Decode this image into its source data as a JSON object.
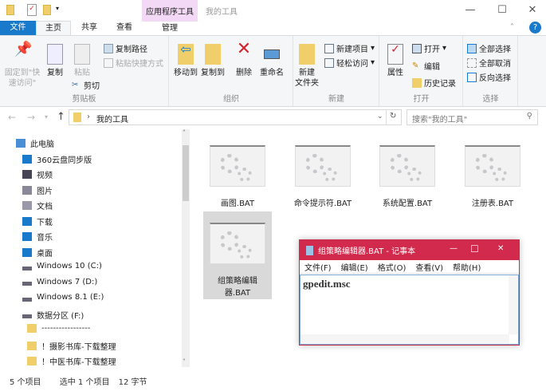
{
  "window": {
    "title": "我的工具",
    "context_group": "应用程序工具",
    "context_tab": "管理",
    "minimize": "—",
    "maximize": "☐",
    "close": "✕"
  },
  "tabs": [
    "文件",
    "主页",
    "共享",
    "查看"
  ],
  "ribbon": {
    "clipboard": {
      "label": "剪贴板",
      "pin": "固定到\"快速访问\"",
      "copy": "复制",
      "paste": "粘贴",
      "copy_path": "复制路径",
      "paste_shortcut": "粘贴快捷方式",
      "cut": "剪切"
    },
    "organize": {
      "label": "组织",
      "move_to": "移动到",
      "copy_to": "复制到",
      "delete": "删除",
      "rename": "重命名"
    },
    "new": {
      "label": "新建",
      "new_folder": "新建\n文件夹",
      "new_item": "新建项目",
      "easy_access": "轻松访问"
    },
    "open": {
      "label": "打开",
      "properties": "属性",
      "open": "打开",
      "edit": "编辑",
      "history": "历史记录"
    },
    "select": {
      "label": "选择",
      "select_all": "全部选择",
      "select_none": "全部取消",
      "invert": "反向选择"
    }
  },
  "address": {
    "path": "我的工具",
    "search_placeholder": "搜索\"我的工具\""
  },
  "nav": [
    "此电脑",
    "360云盘同步版",
    "视频",
    "图片",
    "文档",
    "下载",
    "音乐",
    "桌面",
    "Windows 10 (C:)",
    "Windows 7 (D:)",
    "Windows 8.1 (E:)",
    "数据分区 (F:)",
    "-----------------",
    "！摄影书库-下载整理",
    "！中医书库-下载整理"
  ],
  "files": [
    "画图.BAT",
    "命令提示符.BAT",
    "系统配置.BAT",
    "注册表.BAT",
    "组策略编辑器.BAT"
  ],
  "status": {
    "count": "5 个项目",
    "selected": "选中 1 个项目",
    "size": "12 字节"
  },
  "notepad": {
    "title": "组策略编辑器.BAT - 记事本",
    "menu": [
      "文件(F)",
      "编辑(E)",
      "格式(O)",
      "查看(V)",
      "帮助(H)"
    ],
    "content": "gpedit.msc"
  },
  "colors": {
    "accent": "#1979ca",
    "notepad_title": "#d12a4c"
  }
}
